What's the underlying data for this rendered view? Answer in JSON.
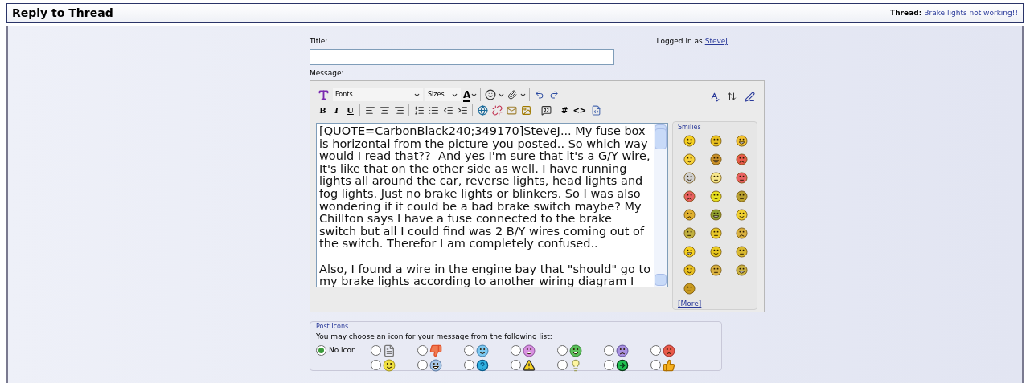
{
  "header": {
    "title": "Reply to Thread",
    "thread_label": "Thread:",
    "thread_title": "Brake lights not working!!"
  },
  "form": {
    "title_label": "Title:",
    "logged_in_text": "Logged in as",
    "user": "SteveJ",
    "message_label": "Message:"
  },
  "toolbar": {
    "font_select": "Fonts",
    "size_select": "Sizes",
    "color_letter": "A",
    "format_buttons": [
      "B",
      "I",
      "U"
    ],
    "tag_buttons": [
      "#",
      "<>"
    ]
  },
  "message": {
    "value": "[QUOTE=CarbonBlack240;349170]SteveJ... My fuse box is horizontal from the picture you posted.. So which way would I read that??  And yes I'm sure that it's a G/Y wire, It's like that on the other side as well. I have running lights all around the car, reverse lights, head lights and fog lights. Just no brake lights or blinkers. So I was also wondering if it could be a bad brake switch maybe? My Chillton says I have a fuse connected to the brake switch but all I could find was 2 B/Y wires coming out of the switch. Therefor I am completely confused..\n\nAlso, I found a wire in the engine bay that \"should\" go to my brake lights according to another wiring diagram I"
  },
  "smilies": {
    "legend": "Smilies",
    "more_link": "[More]"
  },
  "post_icons": {
    "legend": "Post Icons",
    "instruction": "You may choose an icon for your message from the following list:",
    "options": [
      {
        "label": "No icon",
        "selected": true
      },
      {
        "selected": false
      },
      {
        "selected": false
      },
      {
        "selected": false
      },
      {
        "selected": false
      },
      {
        "selected": false
      },
      {
        "selected": false
      },
      {
        "selected": false
      },
      {
        "selected": false
      },
      {
        "selected": false
      },
      {
        "selected": false
      },
      {
        "selected": false
      },
      {
        "selected": false
      },
      {
        "selected": false
      },
      {
        "selected": false
      }
    ]
  }
}
